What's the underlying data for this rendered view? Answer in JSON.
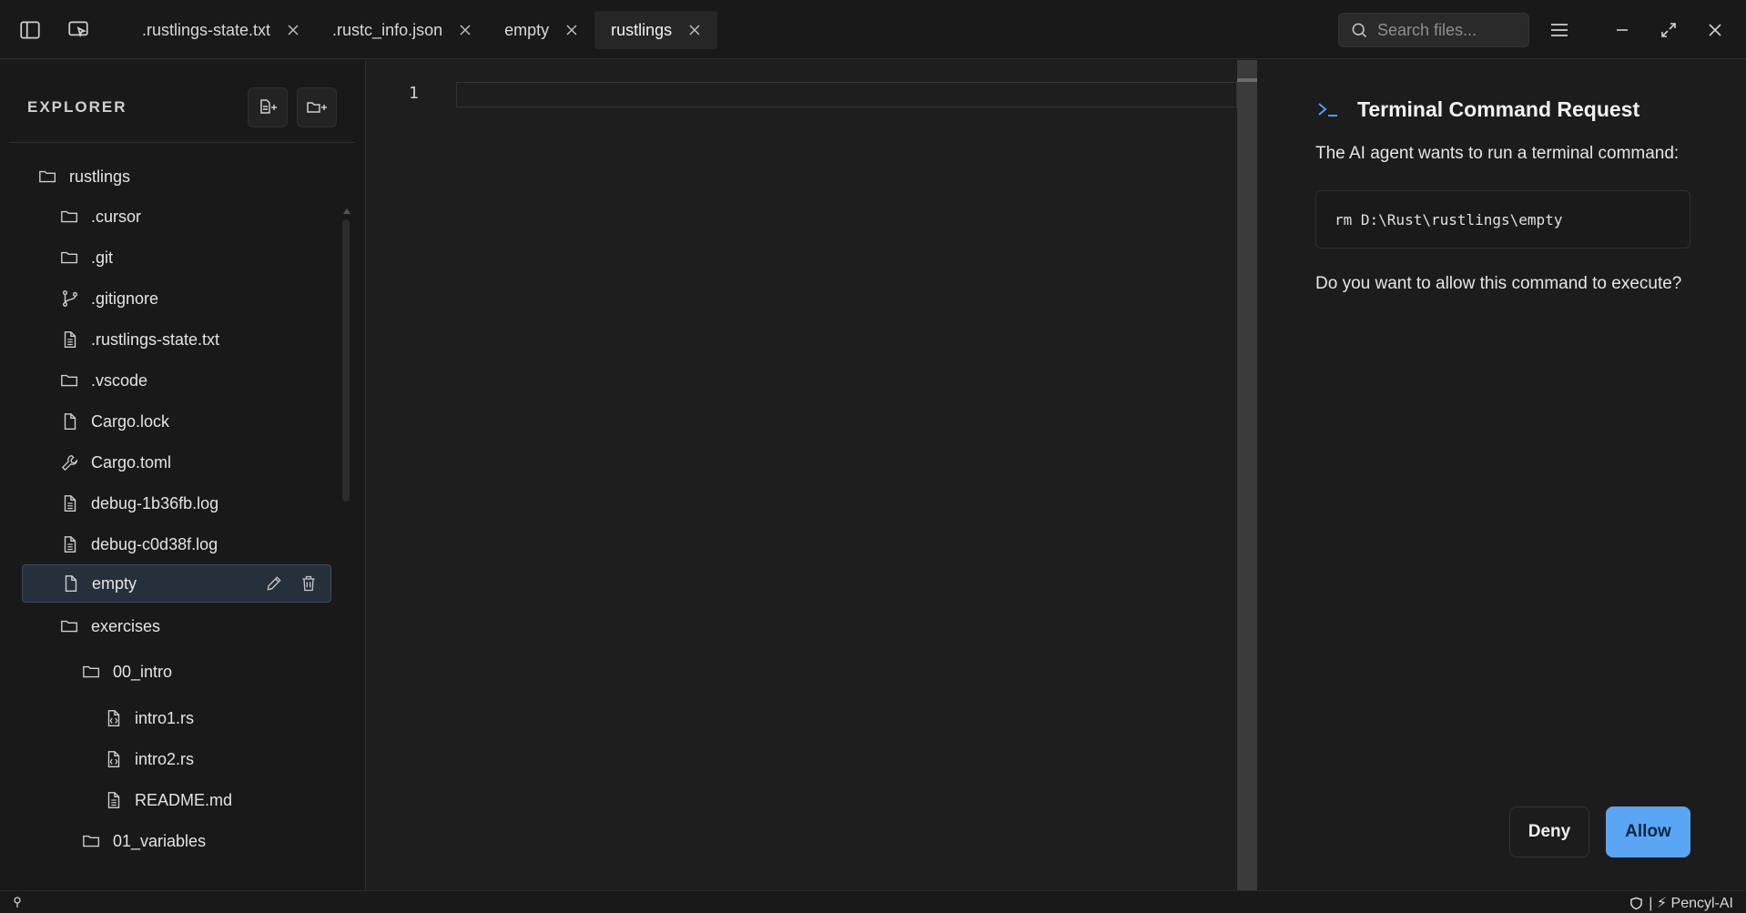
{
  "tabs": [
    {
      "label": ".rustlings-state.txt"
    },
    {
      "label": ".rustc_info.json"
    },
    {
      "label": "empty"
    },
    {
      "label": "rustlings",
      "active": true
    }
  ],
  "search": {
    "placeholder": "Search files..."
  },
  "explorer": {
    "title": "EXPLORER",
    "tree": [
      {
        "label": "rustlings",
        "icon": "folder-icon"
      },
      {
        "label": ".cursor",
        "icon": "folder-icon"
      },
      {
        "label": ".git",
        "icon": "folder-icon"
      },
      {
        "label": ".gitignore",
        "icon": "git-branch-icon"
      },
      {
        "label": ".rustlings-state.txt",
        "icon": "file-text-icon"
      },
      {
        "label": ".vscode",
        "icon": "folder-icon"
      },
      {
        "label": "Cargo.lock",
        "icon": "file-icon"
      },
      {
        "label": "Cargo.toml",
        "icon": "wrench-icon"
      },
      {
        "label": "debug-1b36fb.log",
        "icon": "file-text-icon"
      },
      {
        "label": "debug-c0d38f.log",
        "icon": "file-text-icon"
      },
      {
        "label": "empty",
        "icon": "file-icon",
        "selected": true
      },
      {
        "label": "exercises",
        "icon": "folder-icon"
      },
      {
        "label": "00_intro",
        "icon": "folder-icon"
      },
      {
        "label": "intro1.rs",
        "icon": "file-code-icon"
      },
      {
        "label": "intro2.rs",
        "icon": "file-code-icon"
      },
      {
        "label": "README.md",
        "icon": "file-text-icon"
      },
      {
        "label": "01_variables",
        "icon": "folder-icon"
      }
    ]
  },
  "editor": {
    "line_number": "1"
  },
  "terminal_request": {
    "title": "Terminal Command Request",
    "description": "The AI agent wants to run a terminal command:",
    "command": "rm D:\\Rust\\rustlings\\empty",
    "question": "Do you want to allow this command to execute?",
    "deny_label": "Deny",
    "allow_label": "Allow",
    "accent_color": "#5aa6f5"
  },
  "statusbar": {
    "right_text": "| ⚡ Pencyl-AI"
  }
}
